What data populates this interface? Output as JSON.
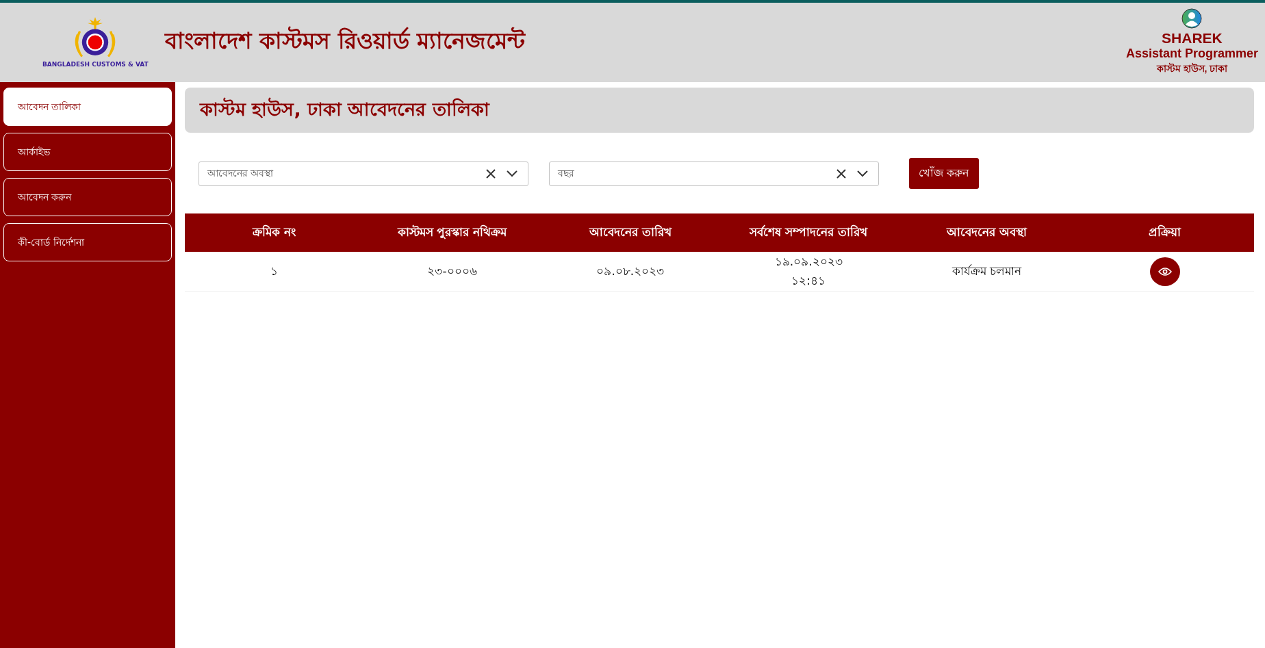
{
  "header": {
    "title": "বাংলাদেশ কাস্টমস রিওয়ার্ড ম্যানেজমেন্ট",
    "logo_text": "BANGLADESH CUSTOMS & VAT",
    "user": {
      "name": "SHAREK",
      "role": "Assistant Programmer",
      "office": "কাস্টম হাউস, ঢাকা"
    }
  },
  "sidebar": {
    "items": [
      {
        "label": "আবেদন তালিকা",
        "selected": true
      },
      {
        "label": "আর্কাইভ",
        "selected": false
      },
      {
        "label": "আবেদন করুন",
        "selected": false
      },
      {
        "label": "কী-বোর্ড নির্দেশনা",
        "selected": false
      }
    ]
  },
  "page_title": "কাস্টম হাউস, ঢাকা আবেদনের তালিকা",
  "filters": [
    {
      "placeholder": "আবেদনের অবস্থা"
    },
    {
      "placeholder": "বছর"
    }
  ],
  "search_button": "খোঁজ করুন",
  "table": {
    "columns": [
      "ক্রমিক নং",
      "কাস্টমস পুরস্কার নথিক্রম",
      "আবেদনের তারিখ",
      "সর্বশেষ সম্পাদনের তারিখ",
      "আবেদনের অবস্থা",
      "প্রক্রিয়া"
    ],
    "rows": [
      {
        "cells": [
          "১",
          "২৩-০০০৬",
          "০৯.০৮.২০২৩",
          "১৯.০৯.২০২৩\n১২:৪১",
          "কার্যক্রম চলমান"
        ]
      }
    ]
  }
}
